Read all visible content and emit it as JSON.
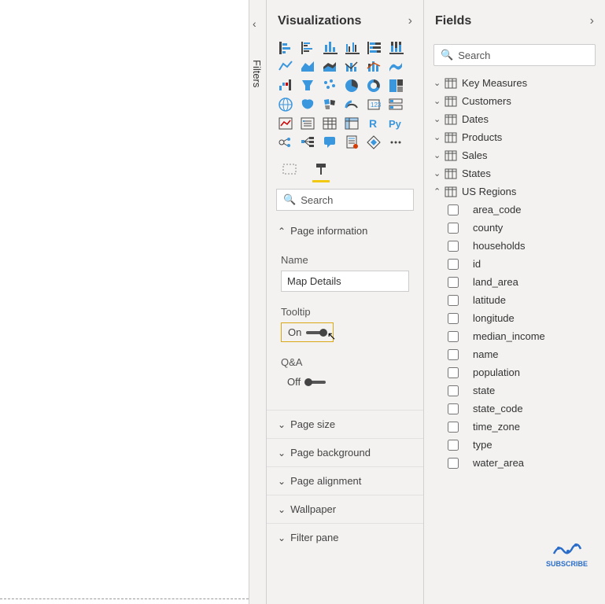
{
  "panels": {
    "filters_label": "Filters",
    "visualizations_title": "Visualizations",
    "fields_title": "Fields"
  },
  "search": {
    "viz_placeholder": "Search",
    "fields_placeholder": "Search"
  },
  "viz_icons": [
    "stacked-bar",
    "clustered-bar",
    "stacked-column",
    "clustered-column",
    "100-stacked-bar",
    "100-stacked-column",
    "line",
    "area",
    "stacked-area",
    "line-clustered",
    "line-stacked",
    "ribbon",
    "waterfall",
    "funnel",
    "scatter",
    "pie",
    "donut",
    "treemap",
    "map",
    "filled-map",
    "shape-map",
    "gauge",
    "card",
    "multi-row-card",
    "kpi",
    "slicer",
    "table",
    "matrix",
    "r-visual",
    "python-visual",
    "key-influencers",
    "decomposition",
    "q-and-a",
    "paginated",
    "power-apps",
    "more"
  ],
  "format_tabs": {
    "general_icon": "general",
    "format_icon": "format-roller",
    "active": "format-roller"
  },
  "format_sections": {
    "page_information": {
      "label": "Page information",
      "expanded": true,
      "name_label": "Name",
      "name_value": "Map Details",
      "tooltip_label": "Tooltip",
      "tooltip_state": "On",
      "tooltip_highlighted": true,
      "qa_label": "Q&A",
      "qa_state": "Off"
    },
    "page_size": {
      "label": "Page size",
      "expanded": false
    },
    "page_background": {
      "label": "Page background",
      "expanded": false
    },
    "page_alignment": {
      "label": "Page alignment",
      "expanded": false
    },
    "wallpaper": {
      "label": "Wallpaper",
      "expanded": false
    },
    "filter_pane": {
      "label": "Filter pane",
      "expanded": false
    }
  },
  "tables": [
    {
      "name": "Key Measures",
      "expanded": false
    },
    {
      "name": "Customers",
      "expanded": false
    },
    {
      "name": "Dates",
      "expanded": false
    },
    {
      "name": "Products",
      "expanded": false
    },
    {
      "name": "Sales",
      "expanded": false
    },
    {
      "name": "States",
      "expanded": false
    },
    {
      "name": "US Regions",
      "expanded": true,
      "fields": [
        "area_code",
        "county",
        "households",
        "id",
        "land_area",
        "latitude",
        "longitude",
        "median_income",
        "name",
        "population",
        "state",
        "state_code",
        "time_zone",
        "type",
        "water_area"
      ]
    }
  ],
  "badge": {
    "label": "SUBSCRIBE"
  }
}
